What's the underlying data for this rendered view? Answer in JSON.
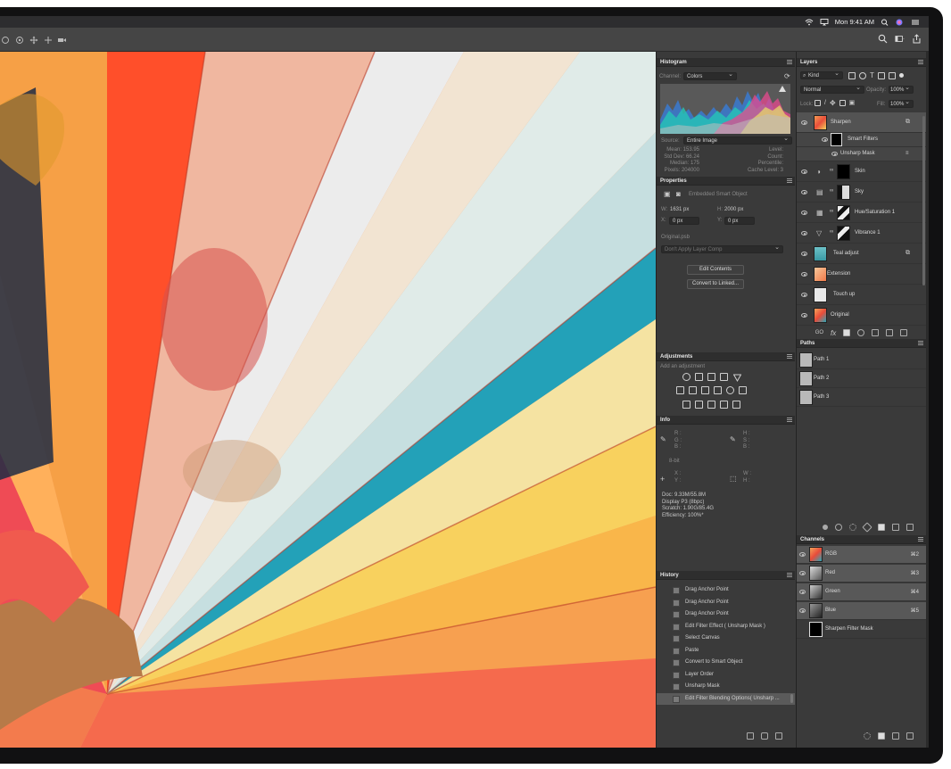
{
  "menubar": {
    "clock": "Mon 9:41 AM"
  },
  "histogram": {
    "title": "Histogram",
    "channel_label": "Channel:",
    "channel_value": "Colors",
    "source_label": "Source:",
    "source_value": "Entire Image",
    "stats_left": [
      "Mean: 153.95",
      "Std Dev: 66.24",
      "Median: 175",
      "Pixels: 204000"
    ],
    "stats_right": [
      "Level:",
      "Count:",
      "Percentile:",
      "Cache Level: 3"
    ]
  },
  "properties": {
    "title": "Properties",
    "object_type": "Embedded Smart Object",
    "w_label": "W:",
    "w_value": "1631 px",
    "h_label": "H:",
    "h_value": "2000 px",
    "x_label": "X:",
    "x_value": "0 px",
    "y_label": "Y:",
    "y_value": "0 px",
    "filename": "Original.psb",
    "layer_comp": "Don't Apply Layer Comp",
    "edit_contents": "Edit Contents",
    "convert_linked": "Convert to Linked..."
  },
  "adjustments": {
    "title": "Adjustments",
    "subtitle": "Add an adjustment"
  },
  "info": {
    "title": "Info",
    "rgb": [
      "R :",
      "G :",
      "B :"
    ],
    "hsb": [
      "H :",
      "S :",
      "B :"
    ],
    "bit": "8-bit",
    "xy": [
      "X :",
      "Y :"
    ],
    "wh": [
      "W :",
      "H :"
    ],
    "doc_lines": [
      "Doc: 9.33M/55.8M",
      "Display P3 (8bpc)",
      "Scratch: 1.90G/85.4G",
      "Efficiency: 100%*"
    ]
  },
  "history": {
    "title": "History",
    "items": [
      "Drag Anchor Point",
      "Drag Anchor Point",
      "Drag Anchor Point",
      "Edit Filter Effect ( Unsharp Mask )",
      "Select Canvas",
      "Paste",
      "Convert to Smart Object",
      "Layer Order",
      "Unsharp Mask",
      "Edit Filter Blending Options( Unsharp ..."
    ]
  },
  "layers": {
    "title": "Layers",
    "kind": "Kind",
    "blend_mode": "Normal",
    "opacity_label": "Opacity:",
    "opacity_value": "100%",
    "lock_label": "Lock:",
    "fill_label": "Fill:",
    "fill_value": "100%",
    "items": [
      {
        "name": "Sharpen"
      },
      {
        "name": "Smart Filters"
      },
      {
        "name": "Unsharp Mask"
      },
      {
        "name": "Skin"
      },
      {
        "name": "Sky"
      },
      {
        "name": "Hue/Saturation 1"
      },
      {
        "name": "Vibrance 1"
      },
      {
        "name": "Teal adjust"
      },
      {
        "name": "Extension"
      },
      {
        "name": "Touch up"
      },
      {
        "name": "Original"
      }
    ]
  },
  "paths": {
    "title": "Paths",
    "items": [
      "Path 1",
      "Path 2",
      "Path 3"
    ]
  },
  "channels": {
    "title": "Channels",
    "items": [
      {
        "name": "RGB",
        "shortcut": "⌘2"
      },
      {
        "name": "Red",
        "shortcut": "⌘3"
      },
      {
        "name": "Green",
        "shortcut": "⌘4"
      },
      {
        "name": "Blue",
        "shortcut": "⌘5"
      },
      {
        "name": "Sharpen Filter Mask",
        "shortcut": ""
      }
    ]
  }
}
